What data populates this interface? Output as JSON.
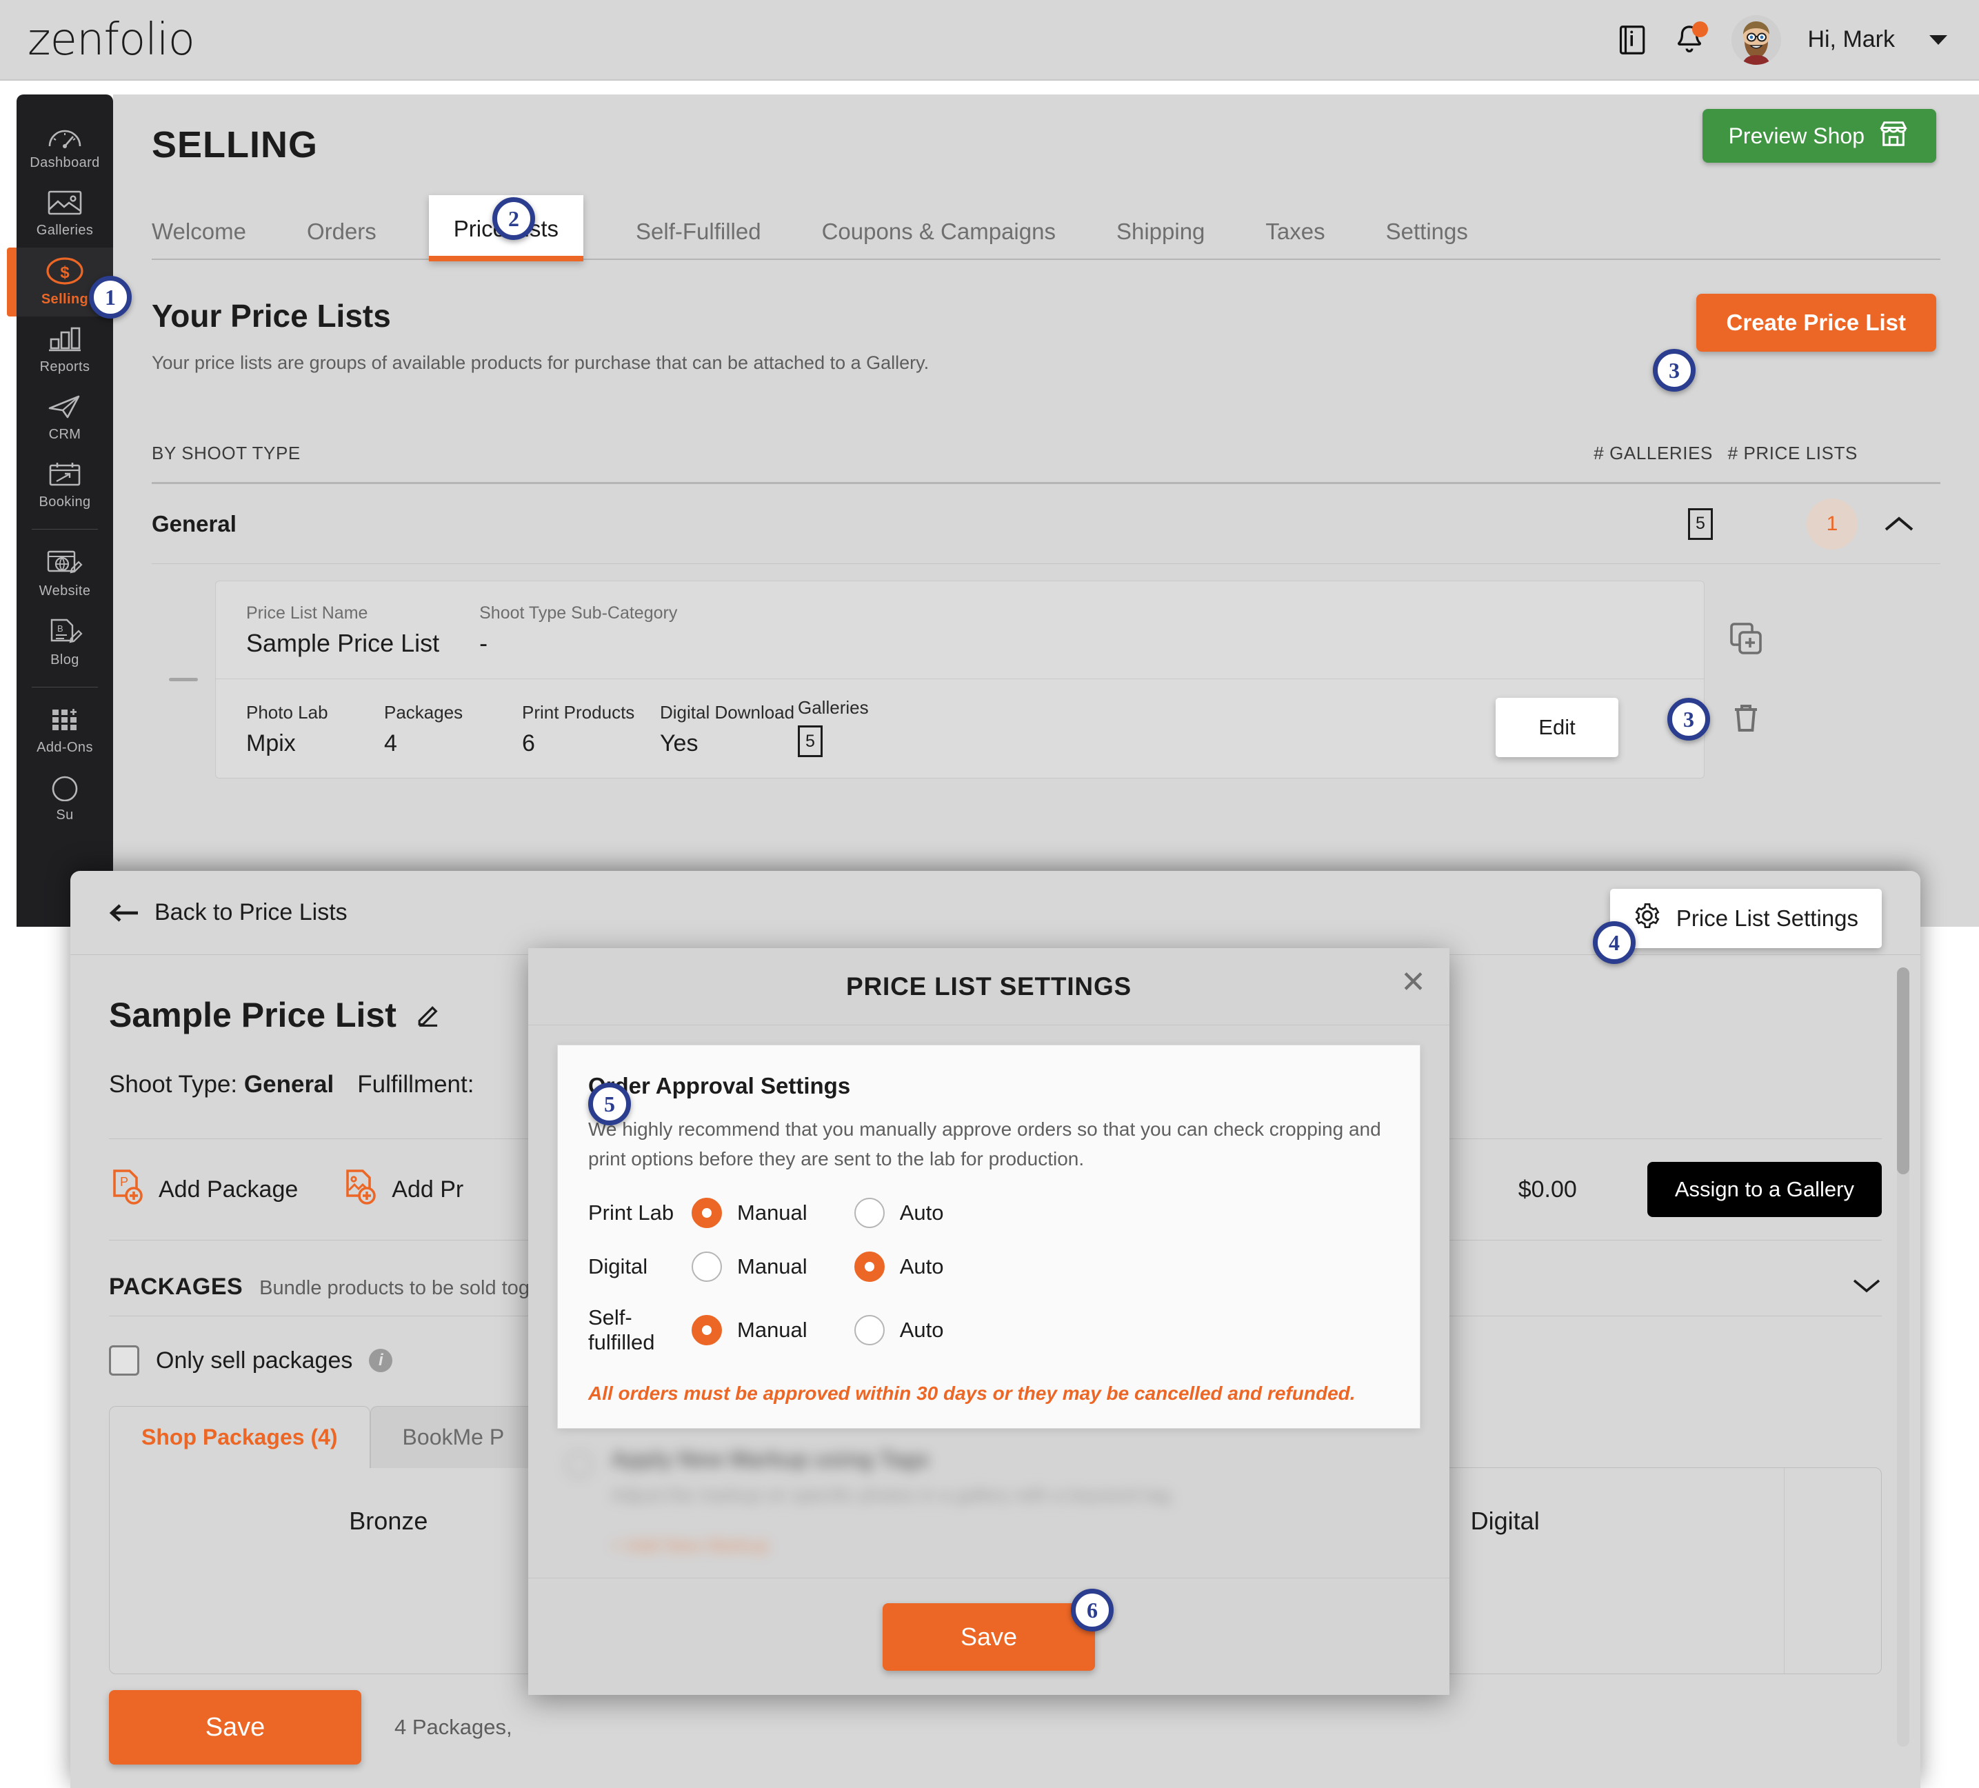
{
  "topbar": {
    "logo": "zenfolio",
    "greeting": "Hi, Mark",
    "icons": {
      "book": "book-info-icon",
      "bell": "bell-icon",
      "avatar": "user-avatar"
    }
  },
  "sidebar": {
    "items": [
      {
        "label": "Dashboard",
        "icon": "gauge-icon",
        "active": false
      },
      {
        "label": "Galleries",
        "icon": "image-icon",
        "active": false
      },
      {
        "label": "Selling",
        "icon": "dollar-circle-icon",
        "active": true
      },
      {
        "label": "Reports",
        "icon": "bar-chart-icon",
        "active": false
      },
      {
        "label": "CRM",
        "icon": "paper-plane-icon",
        "active": false
      },
      {
        "label": "Booking",
        "icon": "calendar-arrow-icon",
        "active": false
      },
      {
        "label": "Website",
        "icon": "browser-pencil-icon",
        "active": false
      },
      {
        "label": "Blog",
        "icon": "blog-pencil-icon",
        "active": false
      },
      {
        "label": "Add-Ons",
        "icon": "grid-plus-icon",
        "active": false
      },
      {
        "label": "Su",
        "icon": "circle-icon",
        "active": false
      }
    ]
  },
  "page": {
    "title": "SELLING",
    "preview_shop": "Preview Shop",
    "tabs": [
      {
        "label": "Welcome",
        "active": false
      },
      {
        "label": "Orders",
        "active": false
      },
      {
        "label": "Price Lists",
        "active": true
      },
      {
        "label": "Self-Fulfilled",
        "active": false
      },
      {
        "label": "Coupons & Campaigns",
        "active": false
      },
      {
        "label": "Shipping",
        "active": false
      },
      {
        "label": "Taxes",
        "active": false
      },
      {
        "label": "Settings",
        "active": false
      }
    ],
    "section_title": "Your Price Lists",
    "section_sub": "Your price lists are groups of available products for purchase that can be attached to a Gallery.",
    "create_button": "Create Price List"
  },
  "table": {
    "headers": {
      "shoot_type": "BY SHOOT TYPE",
      "galleries": "# GALLERIES",
      "price_lists": "# PRICE LISTS"
    },
    "group": {
      "name": "General",
      "galleries": "5",
      "price_lists": "1"
    },
    "price_list": {
      "name_label": "Price List Name",
      "name_value": "Sample Price List",
      "subcat_label": "Shoot Type Sub-Category",
      "subcat_value": "-",
      "columns": [
        {
          "label": "Photo Lab",
          "value": "Mpix"
        },
        {
          "label": "Packages",
          "value": "4"
        },
        {
          "label": "Print Products",
          "value": "6"
        },
        {
          "label": "Digital Download",
          "value": "Yes"
        },
        {
          "label": "Galleries",
          "value": "5"
        }
      ],
      "edit_button": "Edit",
      "duplicate_icon": "duplicate-icon",
      "delete_icon": "trash-icon"
    }
  },
  "editor": {
    "back_link": "Back to Price Lists",
    "settings_button": "Price List Settings",
    "name": "Sample Price List",
    "edit_name_icon": "pencil-icon",
    "shoot_type_label": "Shoot Type:",
    "shoot_type_value": "General",
    "fulfillment_label": "Fulfillment:",
    "actions": [
      {
        "label": "Add Package",
        "icon": "add-package-icon"
      },
      {
        "label": "Add Pr",
        "icon": "add-product-icon"
      }
    ],
    "total_price": "$0.00",
    "assign_button": "Assign to a Gallery",
    "packages_title": "PACKAGES",
    "packages_sub": "Bundle products to be sold toget",
    "only_sell_packages": "Only sell packages",
    "sub_tabs": [
      {
        "label": "Shop Packages (4)",
        "active": true
      },
      {
        "label": "BookMe P",
        "active": false
      }
    ],
    "package_cards": [
      "Bronze",
      "Digital"
    ],
    "save_button": "Save",
    "footer_note": "4 Packages,"
  },
  "modal": {
    "title": "PRICE LIST SETTINGS",
    "close_icon": "close-icon",
    "card_title": "Order Approval Settings",
    "card_desc": "We highly recommend that you manually approve orders so that you can check cropping and print options before they are sent to the lab for production.",
    "rows": [
      {
        "label": "Print Lab",
        "manual_label": "Manual",
        "auto_label": "Auto",
        "selected": "manual"
      },
      {
        "label": "Digital",
        "manual_label": "Manual",
        "auto_label": "Auto",
        "selected": "auto"
      },
      {
        "label": "Self-fulfilled",
        "manual_label": "Manual",
        "auto_label": "Auto",
        "selected": "manual"
      }
    ],
    "note": "All orders must be approved within 30 days or they may be cancelled and refunded.",
    "blurred": {
      "heading": "Apply New Markup using Tags",
      "desc": "Adjust the markup on specific photos in a gallery with a keyword tag.",
      "link": "+ Add New Markup"
    },
    "save_button": "Save"
  },
  "callouts": [
    {
      "n": "1"
    },
    {
      "n": "2"
    },
    {
      "n": "3"
    },
    {
      "n": "3"
    },
    {
      "n": "4"
    },
    {
      "n": "5"
    },
    {
      "n": "6"
    }
  ],
  "colors": {
    "accent_orange": "#ec6726",
    "green": "#409542",
    "dark_sidebar": "#1f1f22",
    "page_bg": "#d7d7d7",
    "callout_blue": "#2b3d8f"
  }
}
